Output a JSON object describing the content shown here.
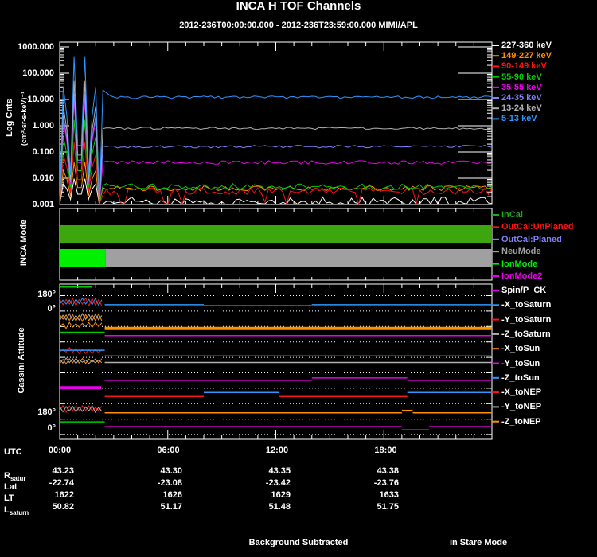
{
  "title": "INCA H TOF Channels",
  "subtitle": "2012-236T00:00:00.000 - 2012-236T23:59:00.000 MIMI/APL",
  "colors": {
    "white": "#ffffff",
    "orange": "#ff9000",
    "red": "#fa1414",
    "green": "#00cc00",
    "magenta": "#ec00ec",
    "slate": "#8282fa",
    "gray": "#b0b0b0",
    "cyan": "#2e96ff",
    "incal": "#20a820",
    "planed": "#8080f8",
    "modegray": "#a0a0a0",
    "brightgreen": "#00f000",
    "modegreen": "#3da60e",
    "axis": "#ffffff"
  },
  "top_panel": {
    "ylabel": "Log Cnts",
    "ylabel_units": "(cm²-sr-s-keV)⁻¹",
    "yticks": [
      "0.001",
      "0.010",
      "0.100",
      "1.000",
      "10.000",
      "100.000",
      "1000.000"
    ],
    "legend": [
      {
        "label": "227-360 keV",
        "color": "white"
      },
      {
        "label": "149-227 keV",
        "color": "orange"
      },
      {
        "label": "90-149 keV",
        "color": "red"
      },
      {
        "label": "55-90 keV",
        "color": "green"
      },
      {
        "label": "35-55 keV",
        "color": "magenta"
      },
      {
        "label": "24-35 keV",
        "color": "slate"
      },
      {
        "label": "13-24 keV",
        "color": "gray"
      },
      {
        "label": "5-13 keV",
        "color": "cyan"
      }
    ]
  },
  "chart_data": {
    "type": "line",
    "title": "INCA H TOF Channels",
    "xlabel": "UTC",
    "ylabel": "Log Cnts (cm²-sr-s-keV)⁻¹",
    "x_range_hours": [
      0,
      24
    ],
    "ylim_log": [
      0.001,
      1500
    ],
    "x_ticks": [
      "00:00",
      "06:00",
      "12:00",
      "18:00"
    ],
    "grid": false,
    "legend_position": "right",
    "calibration": {
      "t_start": 0,
      "t_end": 2.2,
      "cycles": 4,
      "floor": 0.001
    },
    "series": [
      {
        "name": "227-360 keV",
        "color": "white",
        "calib_peak": 0.012,
        "level": 0.0013,
        "noise_dex": 0.18
      },
      {
        "name": "149-227 keV",
        "color": "orange",
        "calib_peak": 0.06,
        "level": 0.0042,
        "noise_dex": 0.1
      },
      {
        "name": "90-149 keV",
        "color": "red",
        "calib_peak": 0.4,
        "level": 0.0032,
        "noise_dex": 0.14
      },
      {
        "name": "55-90 keV",
        "color": "green",
        "calib_peak": 3.5,
        "level": 0.0048,
        "noise_dex": 0.12
      },
      {
        "name": "35-55 keV",
        "color": "magenta",
        "calib_peak": 25,
        "level": 0.04,
        "noise_dex": 0.07
      },
      {
        "name": "24-35 keV",
        "color": "slate",
        "calib_peak": 45,
        "level": 0.16,
        "noise_dex": 0.05
      },
      {
        "name": "13-24 keV",
        "color": "gray",
        "calib_peak": 150,
        "level": 0.8,
        "noise_dex": 0.045
      },
      {
        "name": "5-13 keV",
        "color": "cyan",
        "calib_peak": 1500,
        "level": 12,
        "noise_dex": 0.05
      }
    ]
  },
  "mode_panel": {
    "label": "INCA Mode",
    "legend": [
      {
        "label": "InCal",
        "color": "incal"
      },
      {
        "label": "OutCal:UnPlaned",
        "color": "red"
      },
      {
        "label": "OutCal:Planed",
        "color": "planed"
      },
      {
        "label": "NeuMode",
        "color": "modegray"
      },
      {
        "label": "IonMode",
        "color": "brightgreen"
      },
      {
        "label": "IonMode2",
        "color": "magenta"
      }
    ],
    "bars": [
      {
        "y": 283,
        "h": 22,
        "segments": [
          {
            "t0": 0,
            "t1": 24,
            "color": "modegreen"
          }
        ]
      },
      {
        "y": 313,
        "h": 22,
        "segments": [
          {
            "t0": 0,
            "t1": 2.56,
            "color": "brightgreen"
          },
          {
            "t0": 2.56,
            "t1": 24,
            "color": "modegray"
          }
        ]
      }
    ]
  },
  "attitude_panel": {
    "label": "Cassini Attitude",
    "axis_labels": [
      "180°",
      "0°",
      "180°",
      "0°"
    ],
    "tick_colors": [
      "magenta",
      "cyan",
      "red",
      "gray",
      "orange"
    ],
    "legend": [
      {
        "label": "Spin/P_CK"
      },
      {
        "label": "-X_toSaturn"
      },
      {
        "label": "-Y_toSaturn"
      },
      {
        "label": "-Z_toSaturn"
      },
      {
        "label": "-X_toSun"
      },
      {
        "label": "-Y_toSun"
      },
      {
        "label": "-Z_toSun"
      },
      {
        "label": "-X_toNEP"
      },
      {
        "label": "-Y_toNEP"
      },
      {
        "label": "-Z_toNEP"
      }
    ],
    "rows": [
      {
        "i": 0,
        "segments": [
          {
            "t0": 0,
            "t1": 1.8,
            "color": "green",
            "dy": -11,
            "w": 2
          }
        ]
      },
      {
        "i": 1,
        "calib": {
          "colors": [
            "cyan",
            "red"
          ],
          "t1": 2.4,
          "dy": -8,
          "amp": 7
        },
        "segments": [
          {
            "t0": 2.5,
            "t1": 8,
            "color": "cyan",
            "dy": -8,
            "w": 1.5
          },
          {
            "t0": 8,
            "t1": 14,
            "color": "red",
            "dy": -7,
            "w": 1.5
          },
          {
            "t0": 14,
            "t1": 24,
            "color": "cyan",
            "dy": -8,
            "w": 1.5
          }
        ]
      },
      {
        "i": 2,
        "calib": {
          "colors": [
            "gray",
            "orange"
          ],
          "t1": 2.4,
          "dy": -8,
          "amp": 7
        },
        "segments": []
      },
      {
        "i": 3,
        "calib": {
          "colors": [
            "orange"
          ],
          "t1": 2.4,
          "dy": -18,
          "amp": 6
        },
        "segments": [
          {
            "t0": 0,
            "t1": 2.5,
            "color": "green",
            "dy": -12,
            "w": 2
          },
          {
            "t0": 2.5,
            "t1": 24,
            "color": "orange",
            "dy": -17,
            "w": 4
          },
          {
            "t0": 2.5,
            "t1": 24,
            "color": "magenta",
            "dy": -8,
            "w": 1.5
          }
        ]
      },
      {
        "i": 4,
        "calib": {
          "colors": [
            "red"
          ],
          "t1": 2.4,
          "dy": -6,
          "amp": 5
        },
        "segments": [
          {
            "t0": 0,
            "t1": 2.5,
            "color": "cyan",
            "dy": -9,
            "w": 1.5
          },
          {
            "t0": 2.5,
            "t1": 24,
            "color": "red",
            "dy": -2,
            "w": 1.5
          }
        ]
      },
      {
        "i": 5,
        "calib": {
          "colors": [
            "orange",
            "gray"
          ],
          "t1": 2.4,
          "dy": -12,
          "amp": 5
        },
        "segments": [
          {
            "t0": 2.5,
            "t1": 24,
            "color": "gray",
            "dy": -13,
            "w": 1.5
          }
        ]
      },
      {
        "i": 6,
        "segments": [
          {
            "t0": 2.5,
            "t1": 14,
            "color": "magenta",
            "dy": -10,
            "w": 1.5
          },
          {
            "t0": 14,
            "t1": 19.3,
            "color": "magenta",
            "dy": -13,
            "w": 1.5
          },
          {
            "t0": 19.3,
            "t1": 24,
            "color": "magenta",
            "dy": -10,
            "w": 1.5
          }
        ]
      },
      {
        "i": 7,
        "segments": [
          {
            "t0": 0,
            "t1": 2.3,
            "color": "magenta",
            "dy": -20,
            "w": 4
          },
          {
            "t0": 2.5,
            "t1": 8,
            "color": "red",
            "dy": -9,
            "w": 1.5
          },
          {
            "t0": 8,
            "t1": 12.2,
            "color": "cyan",
            "dy": -14,
            "w": 1.5
          },
          {
            "t0": 12.2,
            "t1": 19.3,
            "color": "red",
            "dy": -9,
            "w": 1.5
          },
          {
            "t0": 19.3,
            "t1": 24,
            "color": "cyan",
            "dy": -14,
            "w": 1.5
          }
        ]
      },
      {
        "i": 8,
        "calib": {
          "colors": [
            "red",
            "gray"
          ],
          "t1": 2.4,
          "dy": -10,
          "amp": 6
        },
        "segments": [
          {
            "t0": 2.5,
            "t1": 19,
            "color": "orange",
            "dy": -8,
            "w": 1.5
          },
          {
            "t0": 19,
            "t1": 19.6,
            "color": "orange",
            "dy": -11,
            "w": 1.5
          },
          {
            "t0": 19.6,
            "t1": 24,
            "color": "orange",
            "dy": -8,
            "w": 1.5
          }
        ]
      },
      {
        "i": 9,
        "segments": [
          {
            "t0": 0,
            "t1": 2.5,
            "color": "green",
            "dy": -16,
            "w": 1.5
          },
          {
            "t0": 2.5,
            "t1": 19,
            "color": "magenta",
            "dy": -10,
            "w": 1.5
          },
          {
            "t0": 19,
            "t1": 20.5,
            "color": "magenta",
            "dy": -6,
            "w": 1.5
          },
          {
            "t0": 20.5,
            "t1": 24,
            "color": "magenta",
            "dy": -10,
            "w": 1.5
          }
        ]
      }
    ]
  },
  "time_axis": {
    "label": "UTC",
    "ticks": [
      "00:00",
      "06:00",
      "12:00",
      "18:00"
    ]
  },
  "ephemeris_table": {
    "rows": [
      {
        "label": "R",
        "sub": "satur",
        "values": [
          "43.23",
          "43.30",
          "43.35",
          "43.38"
        ]
      },
      {
        "label": "Lat",
        "sub": "",
        "values": [
          "-22.74",
          "-23.08",
          "-23.42",
          "-23.76"
        ]
      },
      {
        "label": "LT",
        "sub": "",
        "values": [
          "1622",
          "1626",
          "1629",
          "1633"
        ]
      },
      {
        "label": "L",
        "sub": "saturn",
        "values": [
          "50.82",
          "51.17",
          "51.48",
          "51.75"
        ]
      }
    ]
  },
  "footer": {
    "left": "Background Subtracted",
    "right": "in Stare Mode"
  }
}
